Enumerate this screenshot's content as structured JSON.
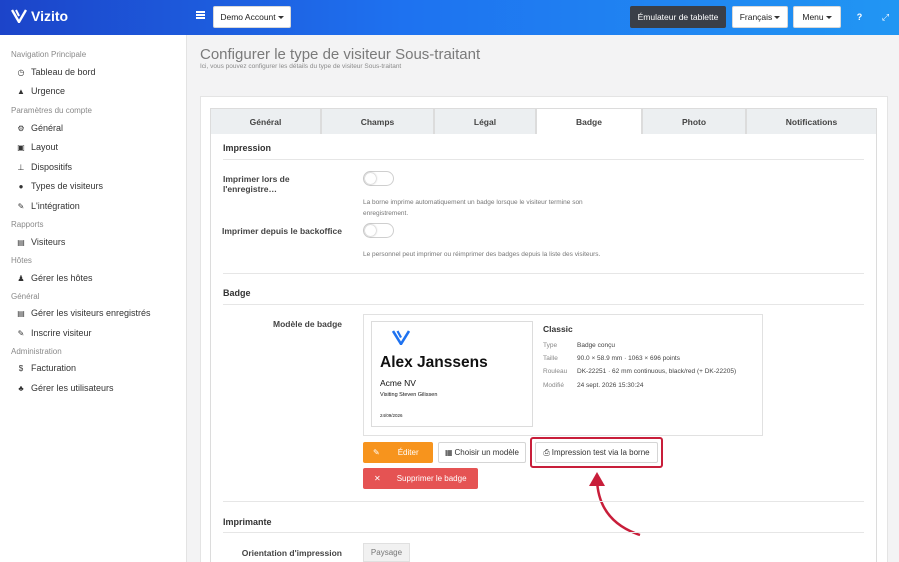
{
  "app": {
    "name": "Vizito"
  },
  "topbar": {
    "account_label": "Demo Account",
    "tablet_emulator_label": "Émulateur de tablette",
    "language_label": "Français",
    "menu_label": "Menu",
    "help_icon": "question-circle-icon",
    "expand_icon": "expand-icon"
  },
  "sidebar": {
    "sections": [
      {
        "title": "Navigation Principale",
        "items": [
          {
            "label": "Tableau de bord",
            "icon": "dashboard-icon"
          },
          {
            "label": "Urgence",
            "icon": "warning-icon"
          }
        ]
      },
      {
        "title": "Paramètres du compte",
        "items": [
          {
            "label": "Général",
            "icon": "gear-icon"
          },
          {
            "label": "Layout",
            "icon": "image-icon"
          },
          {
            "label": "Dispositifs",
            "icon": "sitemap-icon"
          },
          {
            "label": "Types de visiteurs",
            "icon": "users-icon"
          },
          {
            "label": "L'intégration",
            "icon": "plug-icon"
          }
        ]
      },
      {
        "title": "Rapports",
        "items": [
          {
            "label": "Visiteurs",
            "icon": "list-icon"
          }
        ]
      },
      {
        "title": "Hôtes",
        "items": [
          {
            "label": "Gérer les hôtes",
            "icon": "host-icon"
          }
        ]
      },
      {
        "title": "Général",
        "items": [
          {
            "label": "Gérer les visiteurs enregistrés",
            "icon": "list-icon"
          },
          {
            "label": "Inscrire visiteur",
            "icon": "pencil-icon"
          }
        ]
      },
      {
        "title": "Administration",
        "items": [
          {
            "label": "Facturation",
            "icon": "dollar-icon"
          },
          {
            "label": "Gérer les utilisateurs",
            "icon": "user-plus-icon"
          }
        ]
      }
    ]
  },
  "page": {
    "title": "Configurer le type de visiteur Sous-traitant",
    "subtitle": "Ici, vous pouvez configurer les détails du type de visiteur Sous-traitant"
  },
  "tabs": [
    {
      "label": "Général",
      "active": false
    },
    {
      "label": "Champs",
      "active": false
    },
    {
      "label": "Légal",
      "active": false
    },
    {
      "label": "Badge",
      "active": true
    },
    {
      "label": "Photo",
      "active": false
    },
    {
      "label": "Notifications",
      "active": false
    }
  ],
  "impression": {
    "heading": "Impression",
    "print_on_register_label": "Imprimer lors de l'enregistre…",
    "print_on_register_on": false,
    "print_on_register_help": "La borne imprime automatiquement un badge lorsque le visiteur termine son enregistrement.",
    "print_from_backoffice_label": "Imprimer depuis le backoffice",
    "print_from_backoffice_on": false,
    "print_from_backoffice_help": "Le personnel peut imprimer ou réimprimer des badges depuis la liste des visiteurs."
  },
  "badge": {
    "heading": "Badge",
    "model_label": "Modèle de badge",
    "preview": {
      "name": "Alex Janssens",
      "company": "Acme NV",
      "visiting": "Visiting Steven Gilissen",
      "date": "24/09/2026"
    },
    "template_name": "Classic",
    "details": [
      {
        "key": "Type",
        "value": "Badge conçu"
      },
      {
        "key": "Taille",
        "value": "90.0 × 58.9 mm · 1063 × 696 points"
      },
      {
        "key": "Rouleau",
        "value": "DK-22251 · 62 mm continuous, black/red (+ DK-22205)"
      },
      {
        "key": "Modifié",
        "value": "24 sept. 2026 15:30:24"
      }
    ],
    "edit_label": "Éditer",
    "choose_model_label": "Choisir un modèle",
    "test_print_label": "Impression test via la borne",
    "delete_label": "Supprimer le badge"
  },
  "printer": {
    "heading": "Imprimante",
    "orientation_label": "Orientation d'impression",
    "orientation_value": "Paysage"
  },
  "colors": {
    "accent": "#1e72f0",
    "orange": "#f7941d",
    "danger": "#e55353",
    "highlight": "#c81e3a"
  }
}
